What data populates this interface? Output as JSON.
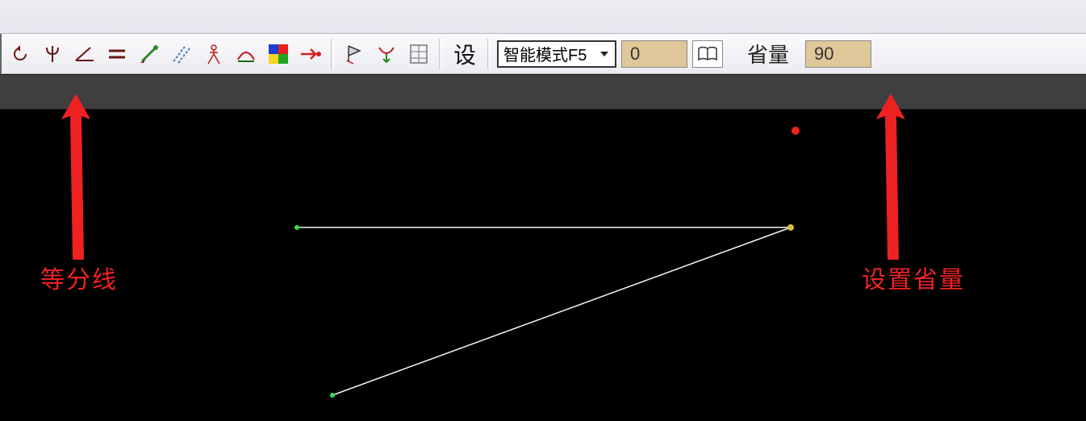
{
  "toolbar": {
    "icons": [
      "rotate-icon",
      "trident-icon",
      "angle-icon",
      "equals-icon",
      "brush-icon",
      "parallel-dash-icon",
      "compass-person-icon",
      "curve-over-icon",
      "color-grid-icon",
      "arrow-dot-icon",
      "flag-triangle-icon",
      "down-curve-icon",
      "grid-panel-icon"
    ],
    "settings_char": "设"
  },
  "dropdown": {
    "selected": "智能模式F5"
  },
  "input1": {
    "value": "0"
  },
  "label_sheng": "省量",
  "input2": {
    "value": "90"
  },
  "annotations": {
    "left": "等分线",
    "right": "设置省量"
  }
}
